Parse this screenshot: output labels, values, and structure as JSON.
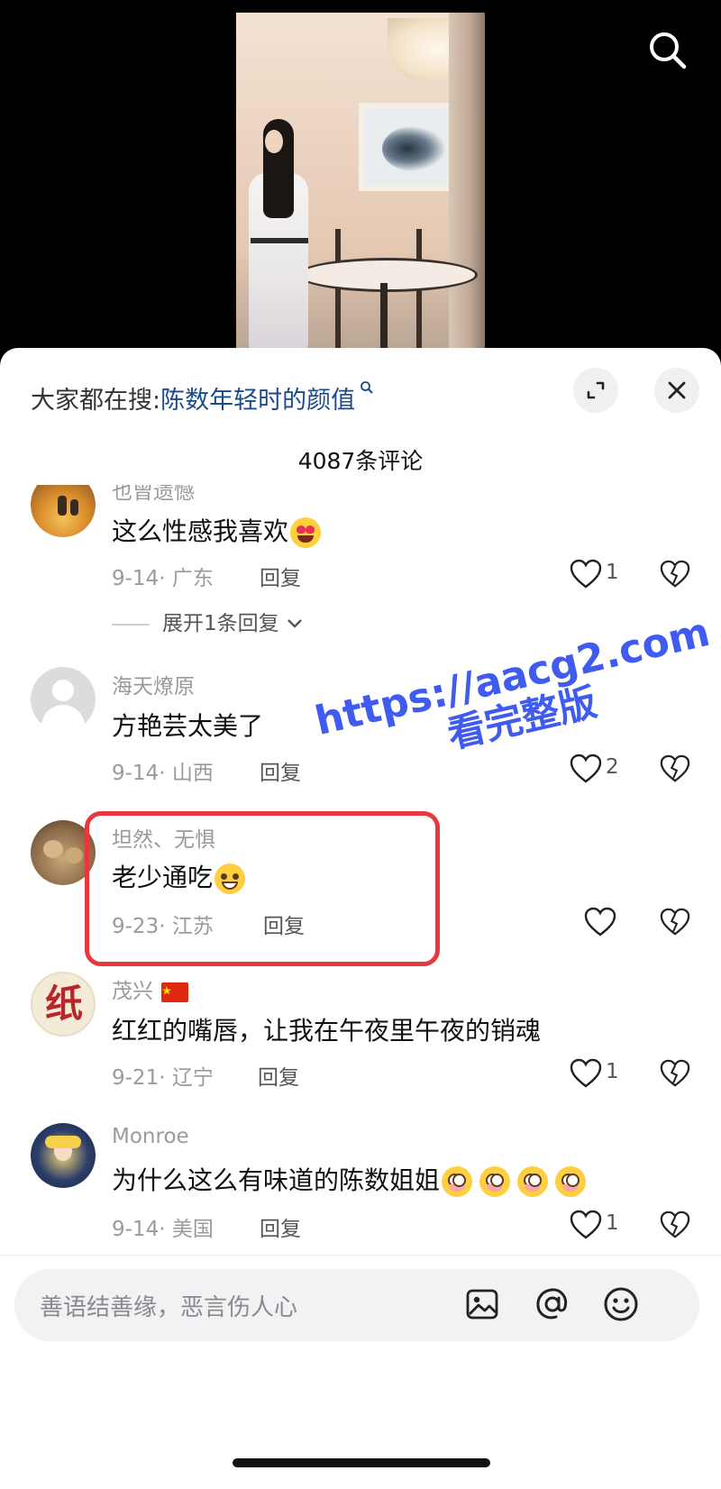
{
  "hot_search": {
    "prefix": "大家都在搜:",
    "term": "陈数年轻时的颜值",
    "icon": "search-mini-icon"
  },
  "comment_count": "4087条评论",
  "comments": [
    {
      "username": "也曾遗憾",
      "text": "这么性感我喜欢",
      "emoji": "heart-eyes",
      "date": "9-14",
      "location": "广东",
      "reply_label": "回复",
      "likes": "1",
      "expand_replies": "展开1条回复"
    },
    {
      "username": "海天燎原",
      "text": "方艳芸太美了",
      "date": "9-14",
      "location": "山西",
      "reply_label": "回复",
      "likes": "2"
    },
    {
      "username": "坦然、无惧",
      "text": "老少通吃",
      "emoji": "grin",
      "date": "9-23",
      "location": "江苏",
      "reply_label": "回复",
      "likes": ""
    },
    {
      "username": "茂兴",
      "username_flag": "china-flag-icon",
      "text": "红红的嘴唇，让我在午夜里午夜的销魂",
      "date": "9-21",
      "location": "辽宁",
      "reply_label": "回复",
      "likes": "1"
    },
    {
      "username": "Monroe",
      "text": "为什么这么有味道的陈数姐姐",
      "emoji": "goofy x4",
      "date": "9-14",
      "location": "美国",
      "reply_label": "回复",
      "likes": "1"
    }
  ],
  "watermark": {
    "line1": "https://aacg2.com",
    "line2": "看完整版",
    "color": "#3f5bf0"
  },
  "input": {
    "placeholder": "善语结善缘，恶言伤人心"
  },
  "colors": {
    "highlight_border": "#e8373f",
    "hot_term": "#1a4b8f"
  }
}
